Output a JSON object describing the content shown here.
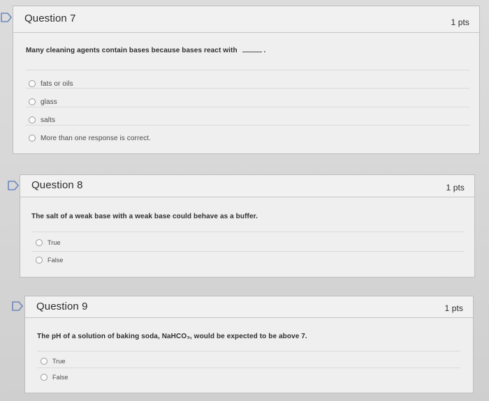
{
  "questions": [
    {
      "title": "Question 7",
      "points": "1 pts",
      "prompt": "Many cleaning agents contain bases because bases react with",
      "prompt_suffix": ".",
      "answers": [
        {
          "label": "fats or oils"
        },
        {
          "label": "glass"
        },
        {
          "label": "salts"
        },
        {
          "label": "More than one response is correct."
        }
      ]
    },
    {
      "title": "Question 8",
      "points": "1 pts",
      "prompt": "The salt of a weak base with a weak base could behave as a buffer.",
      "answers": [
        {
          "label": "True"
        },
        {
          "label": "False"
        }
      ]
    },
    {
      "title": "Question 9",
      "points": "1 pts",
      "prompt": "The pH of a solution of baking soda, NaHCO₃, would be expected to be above 7.",
      "answers": [
        {
          "label": "True"
        },
        {
          "label": "False"
        }
      ]
    }
  ],
  "icons": {
    "flag": "flag-icon",
    "radio": "radio-button-icon"
  },
  "colors": {
    "background": "#d9d9d9",
    "card": "#ededed",
    "border": "#bdbdbd",
    "text": "#2d2d2d",
    "flag": "#6c87bf"
  }
}
